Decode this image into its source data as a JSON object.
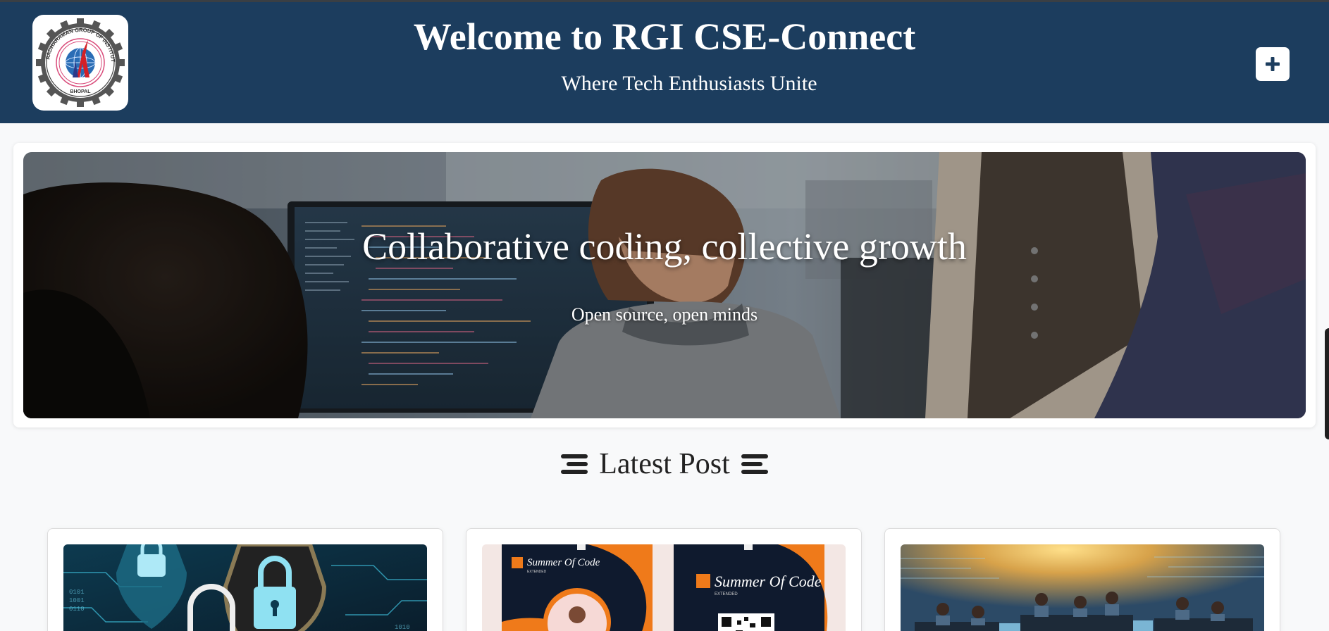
{
  "header": {
    "title": "Welcome to RGI CSE-Connect",
    "subtitle": "Where Tech Enthusiasts Unite",
    "logo_ring_text": "RADHARAMAN GROUP OF INSTITUTES",
    "logo_bottom_text": "BHOPAL",
    "add_icon": "plus-icon",
    "background_color": "#1c3d5e"
  },
  "hero": {
    "title": "Collaborative coding, collective growth",
    "subtitle": "Open source, open minds"
  },
  "latest_post": {
    "heading": "Latest Post",
    "icon": "bars-icon"
  },
  "posts": [
    {
      "image": "cybersecurity-padlock-image"
    },
    {
      "image": "girlscript-summer-of-code-posters",
      "poster_brand": "Summer Of Code",
      "poster_tag": "EXTENDED"
    },
    {
      "image": "students-coding-classroom-image"
    }
  ]
}
